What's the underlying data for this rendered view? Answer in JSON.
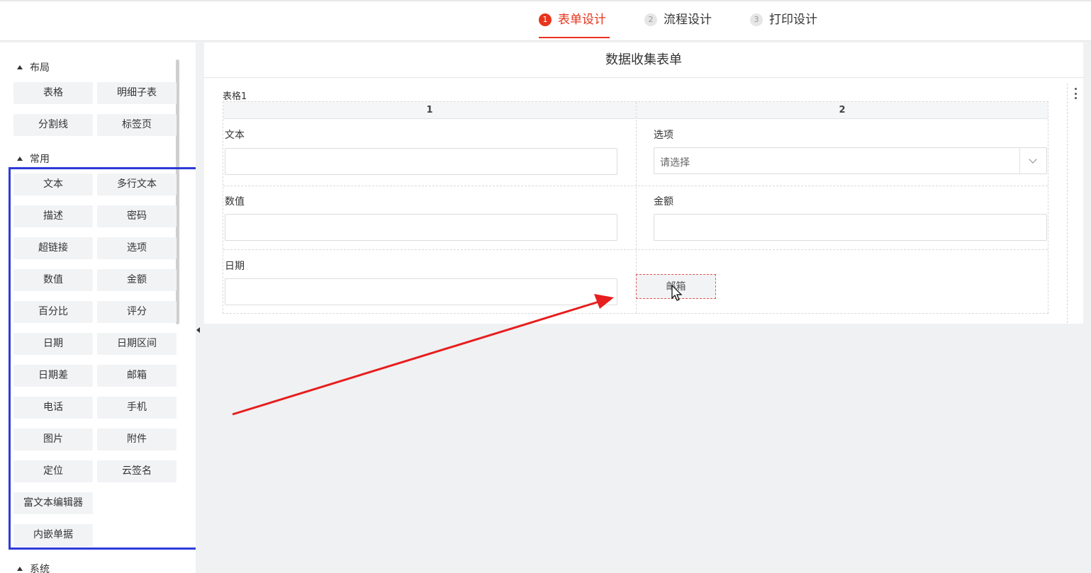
{
  "steps": [
    {
      "num": "1",
      "label": "表单设计"
    },
    {
      "num": "2",
      "label": "流程设计"
    },
    {
      "num": "3",
      "label": "打印设计"
    }
  ],
  "palette": {
    "layout_title": "布局",
    "layout_items": [
      "表格",
      "明细子表",
      "分割线",
      "标签页"
    ],
    "common_title": "常用",
    "common_items": [
      "文本",
      "多行文本",
      "描述",
      "密码",
      "超链接",
      "选项",
      "数值",
      "金额",
      "百分比",
      "评分",
      "日期",
      "日期区间",
      "日期差",
      "邮箱",
      "电话",
      "手机",
      "图片",
      "附件",
      "定位",
      "云签名",
      "富文本编辑器",
      "内嵌单据"
    ],
    "system_title": "系统"
  },
  "form": {
    "title": "数据收集表单",
    "table_label": "表格1",
    "col1": "1",
    "col2": "2",
    "fields": {
      "text_label": "文本",
      "option_label": "选项",
      "option_placeholder": "请选择",
      "number_label": "数值",
      "amount_label": "金额",
      "date_label": "日期"
    },
    "drag_item": "邮箱"
  },
  "colors": {
    "accent": "#e8341c",
    "highlight": "#2e3ad8",
    "arrow": "#e61e1e"
  },
  "icons": [
    "more-vertical-icon",
    "chevron-down-icon",
    "drag-cursor-icon",
    "collapse-left-icon"
  ]
}
